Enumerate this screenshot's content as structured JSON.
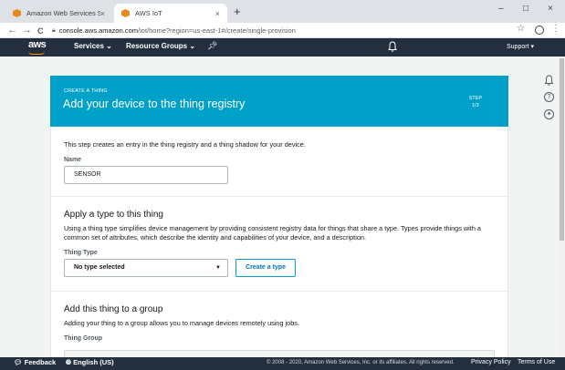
{
  "browser": {
    "tabs": [
      {
        "title": "Amazon Web Services Sign-In",
        "close": "×",
        "favicon": "aws-favicon"
      },
      {
        "title": "AWS IoT",
        "close": "×",
        "favicon": "aws-favicon"
      }
    ],
    "new_tab": "+",
    "window_controls": [
      "–",
      "□",
      "×"
    ],
    "url_host": "console.aws.amazon.com",
    "url_path": "/iot/home?region=us-east-1#/create/single-provision",
    "nav": {
      "back": "←",
      "forward": "→",
      "reload": "C"
    }
  },
  "aws_header": {
    "logo": "aws",
    "services": "Services ⌄",
    "resource_groups": "Resource Groups ⌄",
    "support": "Support ▾",
    "brand_color": "#232f3e",
    "accent": "#ff9900"
  },
  "side_icons": {
    "notifications": "bell-icon",
    "help": "?",
    "feedback": "compass-icon"
  },
  "wizard": {
    "eyebrow": "CREATE A THING",
    "title": "Add your device to the thing registry",
    "step_label": "STEP",
    "step_value": "1/3",
    "header_color": "#00a1c9",
    "intro": "This step creates an entry in the thing registry and a thing shadow for your device.",
    "name_label": "Name",
    "name_value": "SENSOR",
    "type_section": {
      "title": "Apply a type to this thing",
      "description": "Using a thing type simplifies device management by providing consistent registry data for things that share a type. Types provide things with a common set of attributes, which describe the identity and capabilities of your device, and a description.",
      "field_label": "Thing Type",
      "select_value": "No type selected",
      "create_button": "Create a type"
    },
    "group_section": {
      "title": "Add this thing to a group",
      "description": "Adding your thing to a group allows you to manage devices remotely using jobs.",
      "field_label": "Thing Group"
    }
  },
  "footer": {
    "feedback": "Feedback",
    "language": "English (US)",
    "copyright": "© 2008 - 2020, Amazon Web Services, Inc. or its affiliates. All rights reserved.",
    "privacy": "Privacy Policy",
    "terms": "Terms of Use"
  }
}
